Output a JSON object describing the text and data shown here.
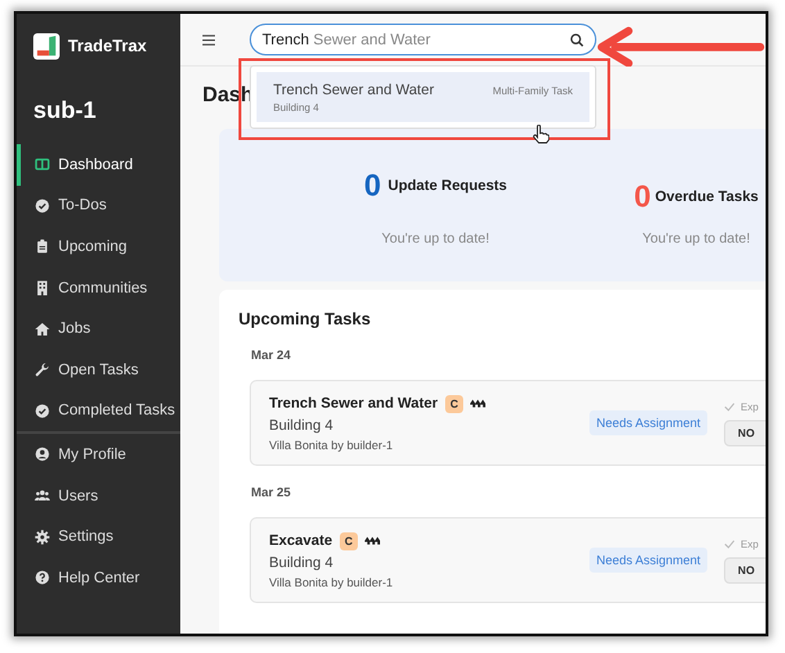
{
  "app": {
    "brand": "TradeTrax",
    "account": "sub-1"
  },
  "nav": [
    {
      "label": "Dashboard",
      "selected": true
    },
    {
      "label": "To-Dos",
      "selected": false
    },
    {
      "label": "Upcoming",
      "selected": false
    },
    {
      "label": "Communities",
      "selected": false
    },
    {
      "label": "Jobs",
      "selected": false
    },
    {
      "label": "Open Tasks",
      "selected": false
    },
    {
      "label": "Completed Tasks",
      "selected": false
    }
  ],
  "account_nav": [
    {
      "label": "My Profile",
      "selected": false
    },
    {
      "label": "Users",
      "selected": false
    },
    {
      "label": "Settings",
      "selected": false
    },
    {
      "label": "Help Center",
      "selected": false
    }
  ],
  "search": {
    "value": "**Trench** Sewer and Water"
  },
  "search_results": [
    {
      "title": "Trench Sewer and Water",
      "subtitle": "Building 4",
      "type": "Multi-Family Task",
      "selected": true
    }
  ],
  "page": {
    "heading": "Dash"
  },
  "summary": [
    {
      "count": "0",
      "label": "Update Requests",
      "note": "You're up to date!",
      "color": "#1565c0"
    },
    {
      "count": "0",
      "label": "Overdue Tasks",
      "note": "You're up to date!",
      "color": "#f4574a"
    }
  ],
  "upcoming": {
    "title": "Upcoming Tasks",
    "groups": [
      {
        "date": "Mar 24",
        "tasks": [
          {
            "title": "Trench Sewer and Water",
            "badge": "C",
            "building": "Building 4",
            "community": "Villa Bonita by builder-1",
            "status": "Needs Assignment",
            "check_label": "Exp",
            "button": "NO"
          }
        ]
      },
      {
        "date": "Mar 25",
        "tasks": [
          {
            "title": "Excavate",
            "badge": "C",
            "building": "Building 4",
            "community": "Villa Bonita by builder-1",
            "status": "Needs Assignment",
            "check_label": "Exp",
            "button": "NO"
          }
        ]
      }
    ]
  }
}
